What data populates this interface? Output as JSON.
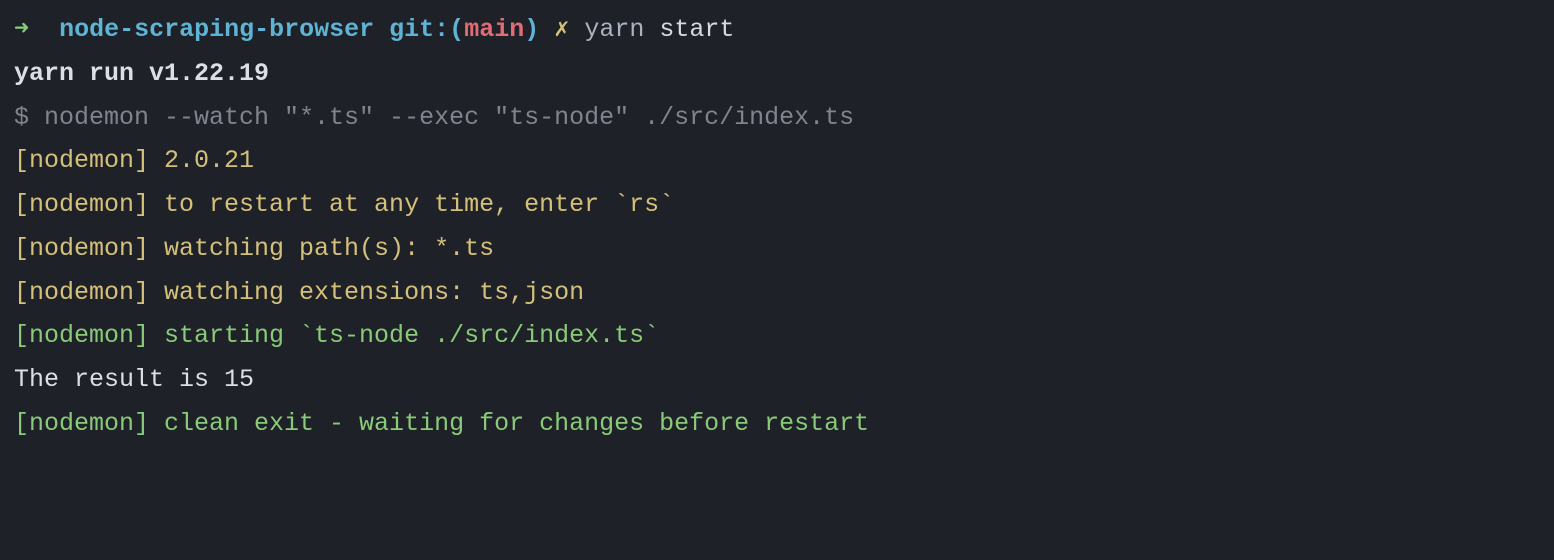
{
  "prompt": {
    "arrow": "➜",
    "dirname": "node-scraping-browser",
    "git_label": "git:",
    "git_paren_open": "(",
    "git_branch": "main",
    "git_paren_close": ")",
    "dirty_mark": "✗",
    "command_yarn": "yarn",
    "command_args": "start"
  },
  "lines": {
    "yarn_run": "yarn run v1.22.19",
    "shell_cmd": "$ nodemon --watch \"*.ts\" --exec \"ts-node\" ./src/index.ts",
    "nodemon_version": "[nodemon] 2.0.21",
    "nodemon_restart": "[nodemon] to restart at any time, enter `rs`",
    "nodemon_paths": "[nodemon] watching path(s): *.ts",
    "nodemon_ext": "[nodemon] watching extensions: ts,json",
    "nodemon_starting": "[nodemon] starting `ts-node ./src/index.ts`",
    "result": "The result is 15",
    "nodemon_exit": "[nodemon] clean exit - waiting for changes before restart"
  }
}
